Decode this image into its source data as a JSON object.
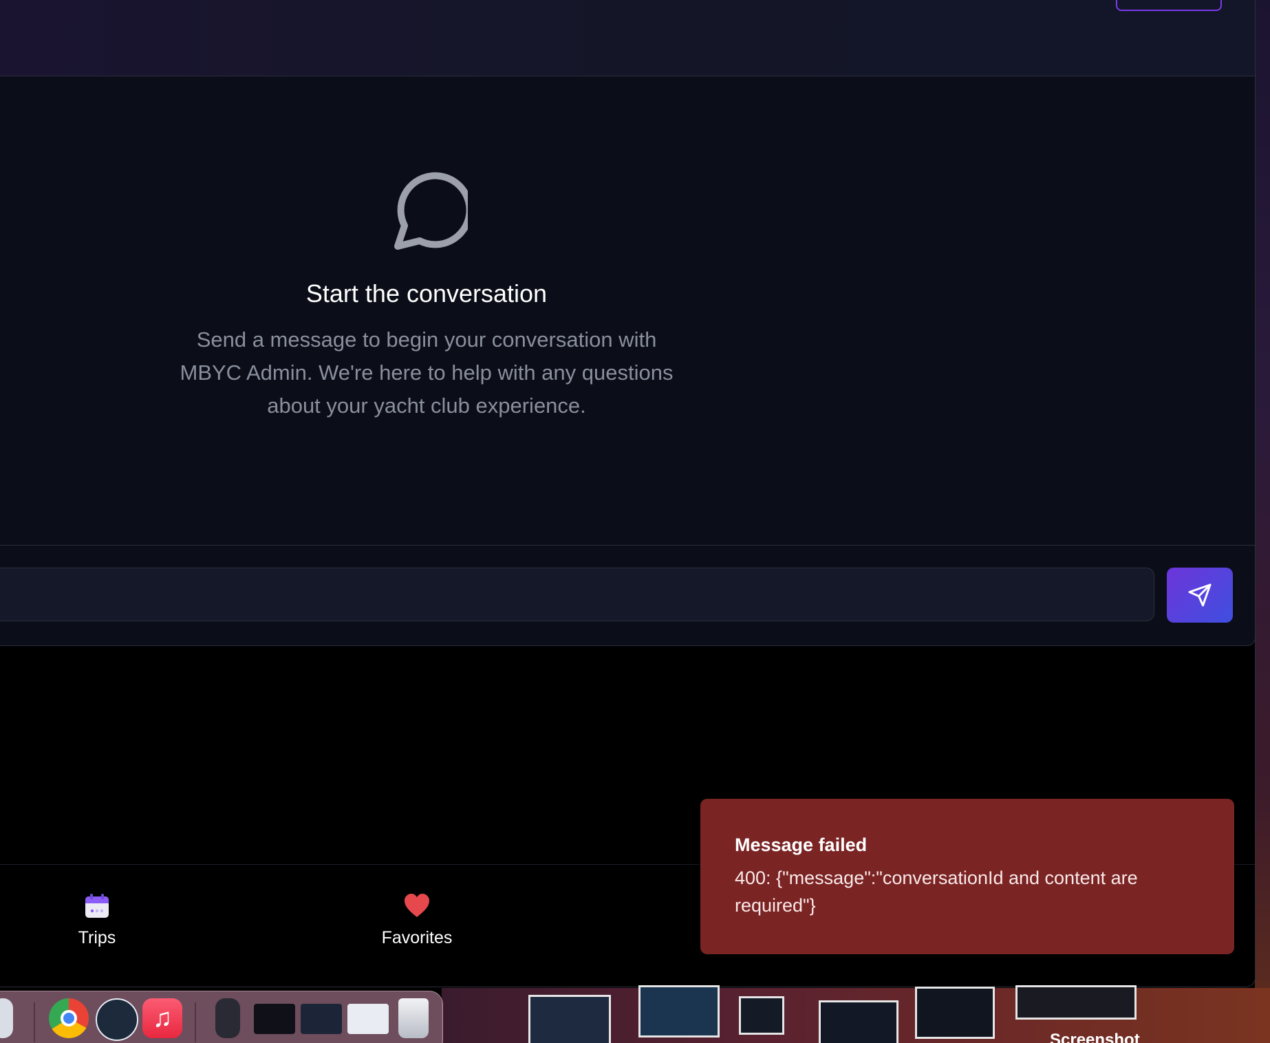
{
  "chat": {
    "empty_title": "Start the conversation",
    "empty_description": "Send a message to begin your conversation with MBYC Admin. We're here to help with any questions about your yacht club experience.",
    "input_placeholder": ""
  },
  "nav": {
    "items": [
      {
        "label": "Trips",
        "icon": "calendar-icon"
      },
      {
        "label": "Favorites",
        "icon": "heart-icon"
      }
    ]
  },
  "toast": {
    "title": "Message failed",
    "body": "400: {\"message\":\"conversationId and content are required\"}"
  },
  "desktop": {
    "label": "Screenshot"
  },
  "colors": {
    "accent": "#7c3aed",
    "send_gradient_start": "#6d35d9",
    "send_gradient_end": "#3f4fe0",
    "toast_bg": "#7a2424",
    "panel_bg": "#0b0e18"
  }
}
